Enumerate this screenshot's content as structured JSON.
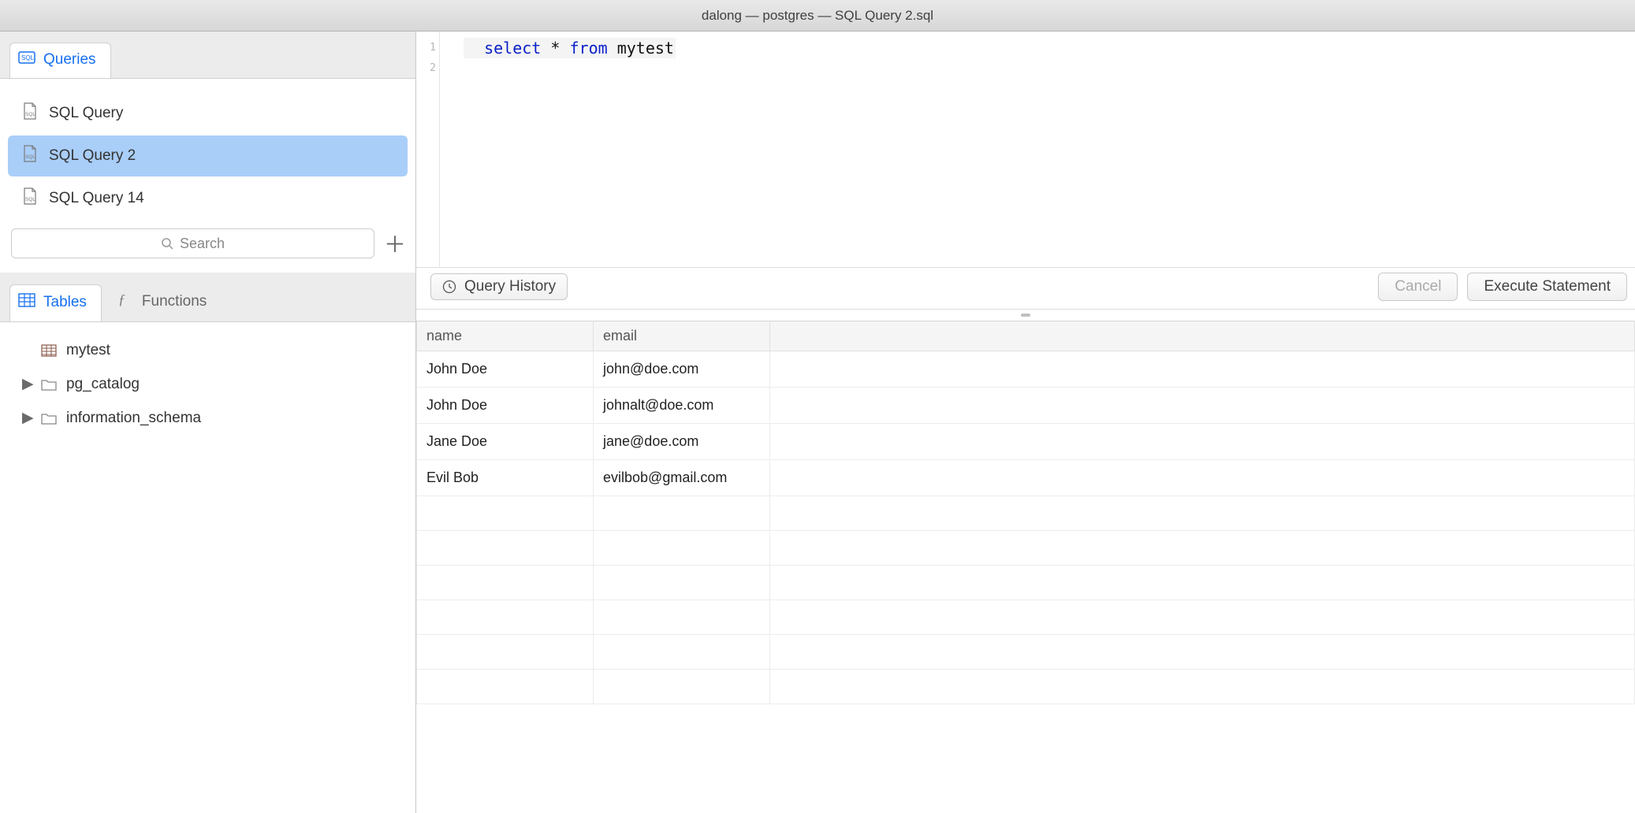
{
  "window_title": "dalong — postgres — SQL Query 2.sql",
  "sidebar_top": {
    "tab_label": "Queries",
    "items": [
      {
        "label": "SQL Query",
        "selected": false
      },
      {
        "label": "SQL Query 2",
        "selected": true
      },
      {
        "label": "SQL Query 14",
        "selected": false
      }
    ],
    "search_placeholder": "Search"
  },
  "sidebar_bottom": {
    "tabs": [
      {
        "label": "Tables",
        "active": true
      },
      {
        "label": "Functions",
        "active": false
      }
    ],
    "tree": [
      {
        "kind": "table",
        "label": "mytest",
        "expandable": false
      },
      {
        "kind": "schema",
        "label": "pg_catalog",
        "expandable": true
      },
      {
        "kind": "schema",
        "label": "information_schema",
        "expandable": true
      }
    ]
  },
  "editor": {
    "line_numbers": [
      "1",
      "2"
    ],
    "sql_tokens": [
      {
        "t": "select",
        "c": "kw"
      },
      {
        "t": " ",
        "c": ""
      },
      {
        "t": "*",
        "c": "tok-star"
      },
      {
        "t": " ",
        "c": ""
      },
      {
        "t": "from",
        "c": "kw"
      },
      {
        "t": " ",
        "c": ""
      },
      {
        "t": "mytest",
        "c": "ident"
      }
    ]
  },
  "toolbar": {
    "history_label": "Query History",
    "cancel_label": "Cancel",
    "execute_label": "Execute Statement"
  },
  "results": {
    "columns": [
      "name",
      "email"
    ],
    "rows": [
      {
        "name": "John Doe",
        "email": "john@doe.com"
      },
      {
        "name": "John Doe",
        "email": "johnalt@doe.com"
      },
      {
        "name": "Jane Doe",
        "email": "jane@doe.com"
      },
      {
        "name": "Evil Bob",
        "email": "evilbob@gmail.com"
      }
    ],
    "empty_rows": 6
  }
}
